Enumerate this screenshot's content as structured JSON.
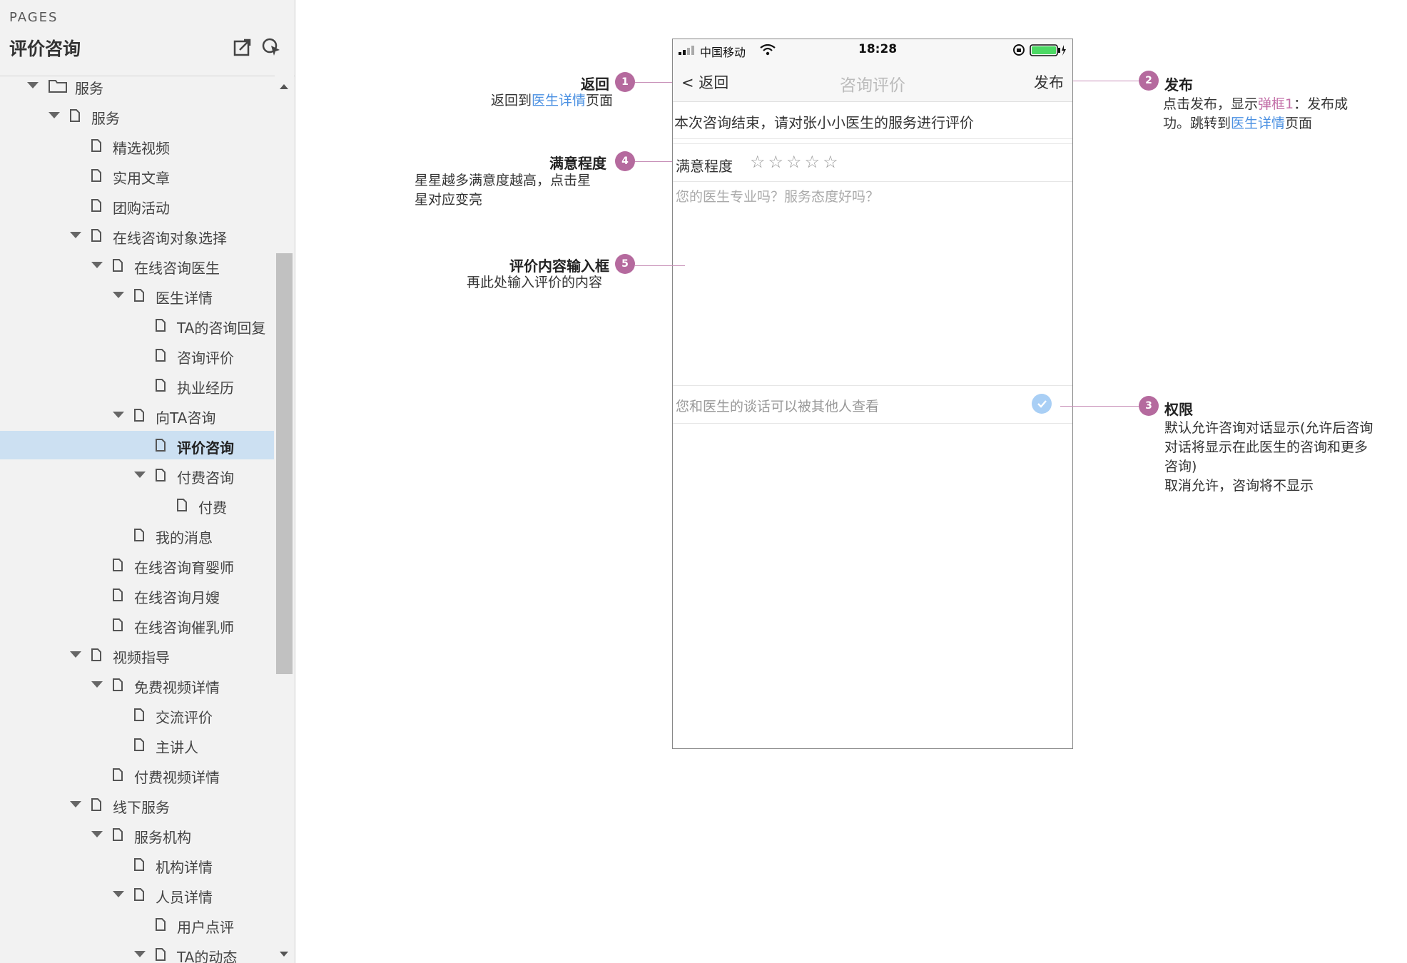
{
  "sidebar": {
    "pages_label": "PAGES",
    "page_name": "评价咨询",
    "tree": [
      {
        "label": "服务",
        "level": 0,
        "expanded": true,
        "folder": true
      },
      {
        "label": "服务",
        "level": 1,
        "expanded": true
      },
      {
        "label": "精选视频",
        "level": 2
      },
      {
        "label": "实用文章",
        "level": 2
      },
      {
        "label": "团购活动",
        "level": 2
      },
      {
        "label": "在线咨询对象选择",
        "level": 2,
        "expanded": true
      },
      {
        "label": "在线咨询医生",
        "level": 3,
        "expanded": true
      },
      {
        "label": "医生详情",
        "level": 4,
        "expanded": true
      },
      {
        "label": "TA的咨询回复",
        "level": 5
      },
      {
        "label": "咨询评价",
        "level": 5
      },
      {
        "label": "执业经历",
        "level": 5
      },
      {
        "label": "向TA咨询",
        "level": 4,
        "expanded": true
      },
      {
        "label": "评价咨询",
        "level": 5,
        "selected": true
      },
      {
        "label": "付费咨询",
        "level": 5,
        "expanded": true
      },
      {
        "label": "付费",
        "level": 6
      },
      {
        "label": "我的消息",
        "level": 4
      },
      {
        "label": "在线咨询育婴师",
        "level": 3
      },
      {
        "label": "在线咨询月嫂",
        "level": 3
      },
      {
        "label": "在线咨询催乳师",
        "level": 3
      },
      {
        "label": "视频指导",
        "level": 2,
        "expanded": true
      },
      {
        "label": "免费视频详情",
        "level": 3,
        "expanded": true
      },
      {
        "label": "交流评价",
        "level": 4
      },
      {
        "label": "主讲人",
        "level": 4
      },
      {
        "label": "付费视频详情",
        "level": 3
      },
      {
        "label": "线下服务",
        "level": 2,
        "expanded": true
      },
      {
        "label": "服务机构",
        "level": 3,
        "expanded": true
      },
      {
        "label": "机构详情",
        "level": 4
      },
      {
        "label": "人员详情",
        "level": 4,
        "expanded": true
      },
      {
        "label": "用户点评",
        "level": 5
      },
      {
        "label": "TA的动态",
        "level": 5,
        "expanded": true
      }
    ]
  },
  "phone": {
    "carrier": "中国移动",
    "time": "18:28",
    "back_label": "< 返回",
    "title": "咨询评价",
    "publish_label": "发布",
    "notice": "本次咨询结束，请对张小小医生的服务进行评价",
    "rating_label": "满意程度",
    "star_glyph": "☆",
    "star_count": 5,
    "review_placeholder": "您的医生专业吗？服务态度好吗？",
    "permission_text": "您和医生的谈话可以被其他人查看"
  },
  "annotations": {
    "a1": {
      "num": "1",
      "title": "返回",
      "desc_pre": "返回到",
      "desc_link": "医生详情",
      "desc_post": "页面"
    },
    "a2": {
      "num": "2",
      "title": "发布",
      "desc_1": "点击发布，显示",
      "desc_pink": "弹框1",
      "desc_2": "：发布成",
      "desc_3": "功。跳转到",
      "desc_link": "医生详情",
      "desc_post": "页面"
    },
    "a3": {
      "num": "3",
      "title": "权限",
      "line1": "默认允许咨询对话显示(允许后咨询",
      "line2": "对话将显示在此医生的咨询和更多",
      "line3": "咨询)",
      "line4": "取消允许，咨询将不显示"
    },
    "a4": {
      "num": "4",
      "title": "满意程度",
      "line1": "星星越多满意度越高，点击星",
      "line2": "星对应变亮"
    },
    "a5": {
      "num": "5",
      "title": "评价内容输入框",
      "desc": "再此处输入评价的内容"
    }
  },
  "colors": {
    "badge": "#b56a9e",
    "link": "#4a90e2",
    "selected_row": "#cce0f2"
  }
}
